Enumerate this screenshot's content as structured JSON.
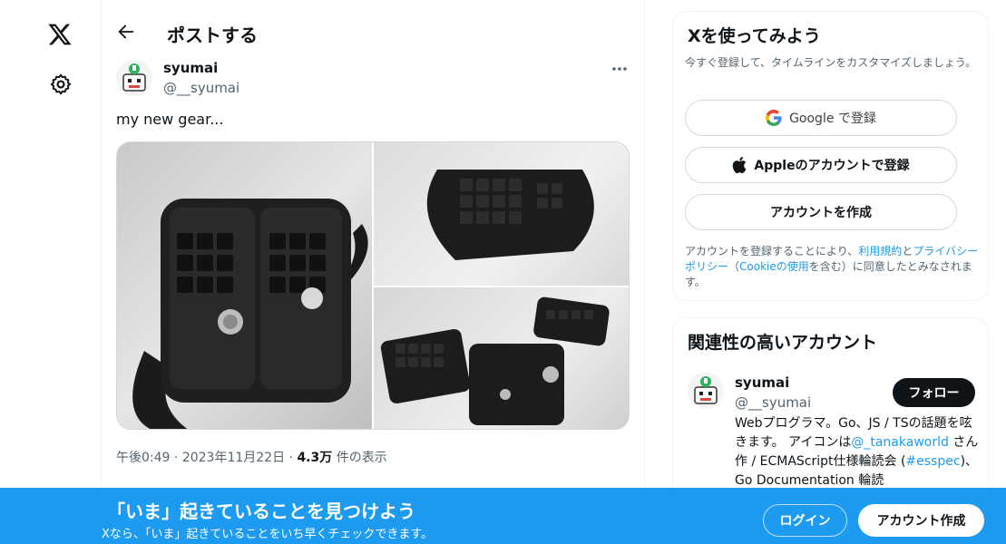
{
  "header": {
    "title": "ポストする"
  },
  "post": {
    "author_name": "syumai",
    "author_handle": "@__syumai",
    "text": "my new gear...",
    "time": "午後0:49",
    "date": "2023年11月22日",
    "separator": "·",
    "views_count": "4.3万",
    "views_label": "件の表示"
  },
  "signup": {
    "title": "Xを使ってみよう",
    "subtitle": "今すぐ登録して、タイムラインをカスタマイズしましょう。",
    "google_label": "Google で登録",
    "apple_label": "Appleのアカウントで登録",
    "create_label": "アカウントを作成",
    "terms": {
      "prefix": "アカウントを登録することにより、",
      "tos": "利用規約",
      "and": "と",
      "privacy": "プライバシーポリシー",
      "open_paren": "（",
      "cookie": "Cookieの使用",
      "suffix": "を含む）に同意したとみなされます。"
    }
  },
  "related": {
    "title": "関連性の高いアカウント",
    "name": "syumai",
    "handle": "@__syumai",
    "follow_label": "フォロー",
    "bio_1": "Webプログラマ。Go、JS / TSの話題を呟きます。 アイコンは",
    "bio_link1": "@_tanakaworld",
    "bio_2": " さん作 / ECMAScript仕様輪読会 (",
    "bio_link2": "#esspec",
    "bio_3": ")、 Go Documentation 輪読"
  },
  "banner": {
    "title": "「いま」起きていることを見つけよう",
    "subtitle": "Xなら、「いま」起きていることをいち早くチェックできます。",
    "login_label": "ログイン",
    "create_label": "アカウント作成"
  },
  "colors": {
    "accent": "#1d9bf0",
    "text": "#0f1419",
    "muted": "#536471"
  },
  "icons": [
    "x-logo-icon",
    "gear-icon",
    "back-arrow-icon",
    "more-icon",
    "google-icon",
    "apple-icon"
  ]
}
